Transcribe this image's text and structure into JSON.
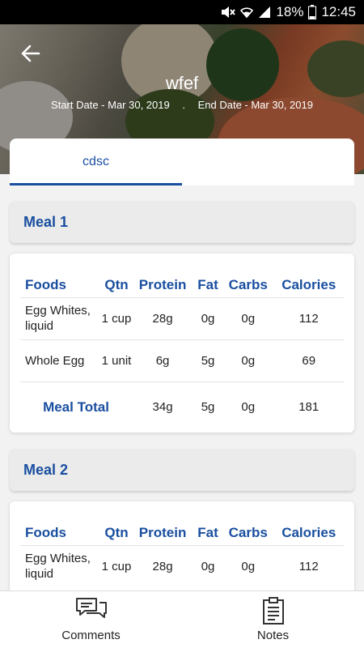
{
  "status_bar": {
    "battery": "18%",
    "time": "12:45",
    "icons": [
      "mute-icon",
      "wifi-icon",
      "signal-icon",
      "battery-icon"
    ]
  },
  "header": {
    "title": "wfef",
    "start_date": "Start Date - Mar 30, 2019",
    "separator": ".",
    "end_date": "End Date - Mar 30, 2019"
  },
  "tabs": [
    {
      "label": "cdsc",
      "active": true
    }
  ],
  "table_headers": [
    "Foods",
    "Qtn",
    "Protein",
    "Fat",
    "Carbs",
    "Calories"
  ],
  "meals": [
    {
      "name": "Meal 1",
      "rows": [
        {
          "food": "Egg Whites, liquid",
          "qtn": "1 cup",
          "protein": "28g",
          "fat": "0g",
          "carbs": "0g",
          "calories": "112"
        },
        {
          "food": "Whole Egg",
          "qtn": "1 unit",
          "protein": "6g",
          "fat": "5g",
          "carbs": "0g",
          "calories": "69"
        }
      ],
      "total": {
        "label": "Meal Total",
        "protein": "34g",
        "fat": "5g",
        "carbs": "0g",
        "calories": "181"
      }
    },
    {
      "name": "Meal 2",
      "rows": [
        {
          "food": "Egg Whites, liquid",
          "qtn": "1 cup",
          "protein": "28g",
          "fat": "0g",
          "carbs": "0g",
          "calories": "112"
        }
      ]
    }
  ],
  "bottom_nav": [
    {
      "label": "Comments",
      "icon": "comments-icon"
    },
    {
      "label": "Notes",
      "icon": "notes-icon"
    }
  ],
  "colors": {
    "accent": "#1a4fa0",
    "status_bar": "#000000",
    "meal_header_bg": "#ebebeb"
  }
}
